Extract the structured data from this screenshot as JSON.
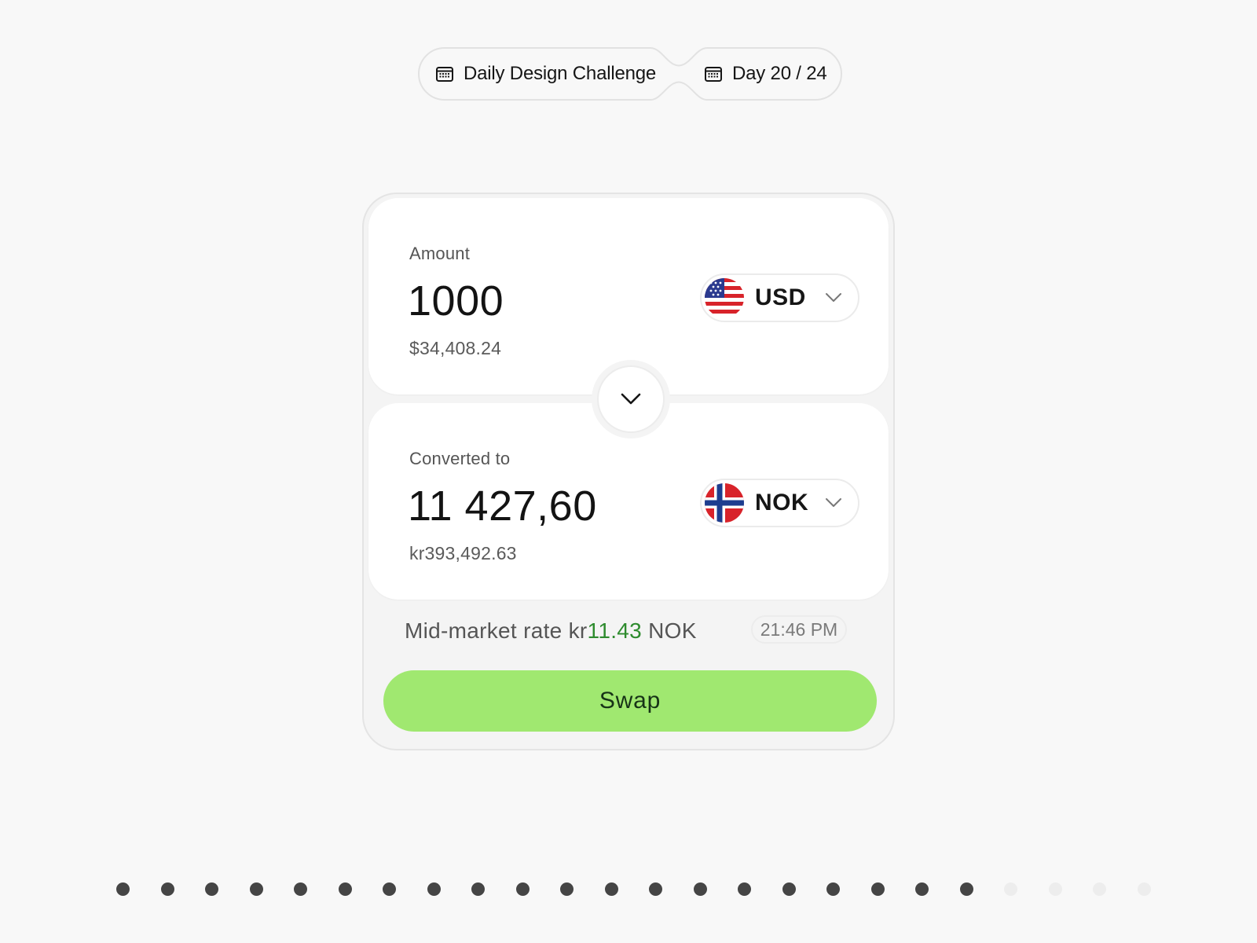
{
  "header": {
    "challenge_label": "Daily Design Challenge",
    "day_label": "Day 20 / 24",
    "icon": "calendar-icon"
  },
  "converter": {
    "from": {
      "label": "Amount",
      "amount": "1000",
      "secondary": "$34,408.24",
      "currency": "USD",
      "flag_icon": "us-flag-icon"
    },
    "to": {
      "label": "Converted to",
      "amount": "11 427,60",
      "secondary": "kr393,492.63",
      "currency": "NOK",
      "flag_icon": "norway-flag-icon"
    },
    "rate": {
      "prefix": "Mid-market rate kr",
      "value": "11.43",
      "suffix": " NOK",
      "time": "21:46 PM"
    },
    "swap_label": "Swap"
  },
  "progress": {
    "current": 20,
    "total": 24
  },
  "colors": {
    "accent_green": "#a0e870",
    "rate_green": "#2e8b2e",
    "background": "#f8f8f8",
    "dot_done": "#454545",
    "dot_todo": "#ededed"
  }
}
